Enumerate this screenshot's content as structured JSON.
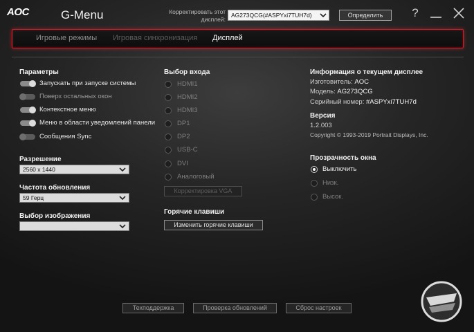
{
  "window": {
    "logo": "AOC",
    "title": "G-Menu",
    "adjust_label": "Корректировать этот дисплей:",
    "display_select": "AG273QCG(#ASPYxi7TUH7d)",
    "identify_button": "Определить",
    "help_glyph": "?"
  },
  "tabs": [
    {
      "label": "Игровые режимы",
      "state": "inactive"
    },
    {
      "label": "Игровая синхронизация",
      "state": "disabled"
    },
    {
      "label": "Дисплей",
      "state": "active"
    }
  ],
  "params": {
    "title": "Параметры",
    "items": [
      {
        "label": "Запускать при запуске системы",
        "on": true
      },
      {
        "label": "Поверх остальных окон",
        "on": false
      },
      {
        "label": "Контекстное меню",
        "on": true
      },
      {
        "label": "Меню в области уведомлений панели",
        "on": true
      },
      {
        "label": "Сообщения Sync",
        "on": false
      }
    ]
  },
  "resolution": {
    "title": "Разрешение",
    "value": "2560 x 1440"
  },
  "refresh": {
    "title": "Частота обновления",
    "value": "59 Герц"
  },
  "image": {
    "title": "Выбор изображения",
    "value": ""
  },
  "input": {
    "title": "Выбор входа",
    "options": [
      "HDMI1",
      "HDMI2",
      "HDMI3",
      "DP1",
      "DP2",
      "USB-C",
      "DVI",
      "Аналоговый"
    ],
    "vga_button": "Корректировка VGA"
  },
  "hotkeys": {
    "title": "Горячие клавиши",
    "button": "Изменить горячие клавиши"
  },
  "info": {
    "title": "Информация о текущем дисплее",
    "manufacturer_label": "Изготовитель:",
    "manufacturer": "AOC",
    "model_label": "Модель:",
    "model": "AG273QCG",
    "serial_label": "Серийный номер:",
    "serial": "#ASPYxi7TUH7d",
    "version_title": "Версия",
    "version": "1.2.003",
    "copyright": "Copyright © 1993-2019 Portrait Displays, Inc."
  },
  "transparency": {
    "title": "Прозрачность окна",
    "options": [
      {
        "label": "Выключить",
        "selected": true
      },
      {
        "label": "Низк.",
        "selected": false
      },
      {
        "label": "Высок.",
        "selected": false
      }
    ]
  },
  "footer": {
    "support": "Техподдержка",
    "updates": "Проверка обновлений",
    "reset": "Сброс настроек"
  },
  "colors": {
    "accent_red": "#c9222b",
    "background": "#262626"
  }
}
